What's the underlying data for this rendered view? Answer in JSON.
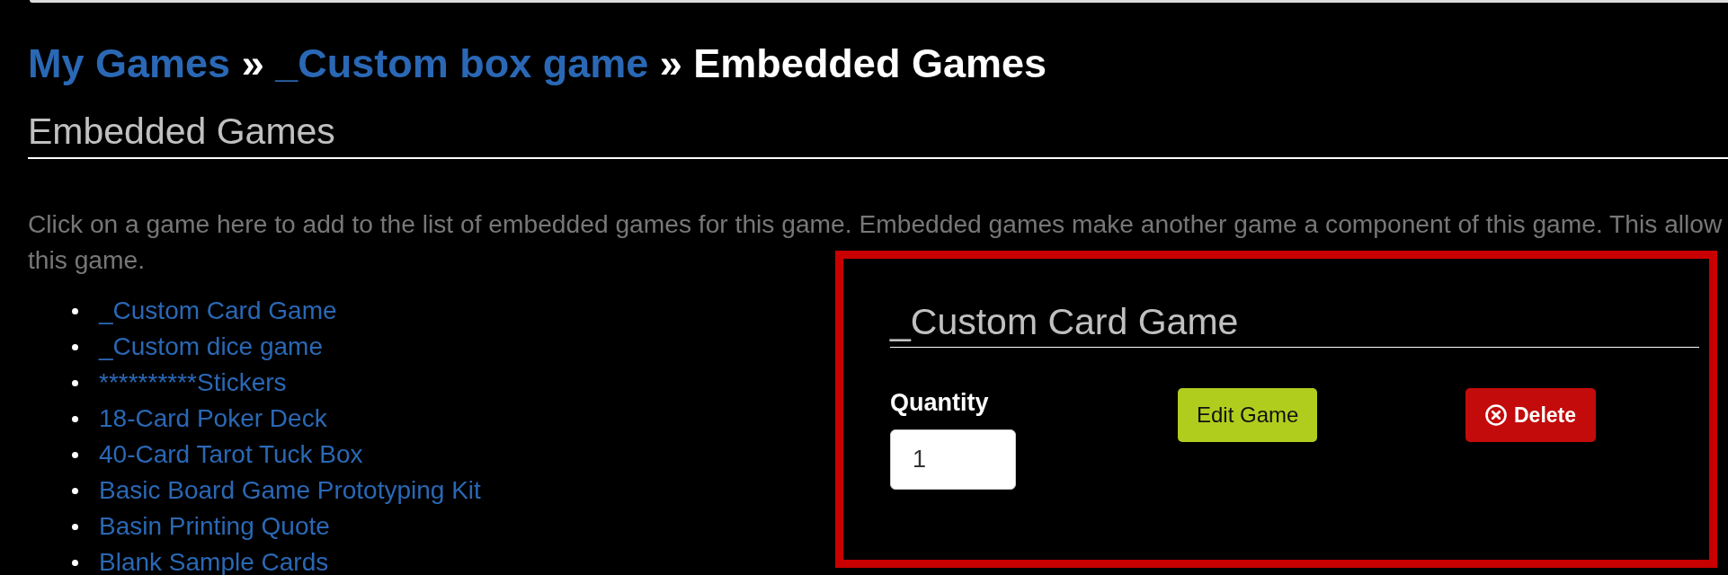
{
  "breadcrumb": {
    "items": [
      {
        "label": "My Games",
        "current": false
      },
      {
        "label": "_Custom box game",
        "current": false
      },
      {
        "label": "Embedded Games",
        "current": true
      }
    ],
    "separators": [
      "»",
      "»"
    ]
  },
  "heading": "Embedded Games",
  "description": {
    "lines": [
      "Click on a game here to add to the list of embedded games for this game. Embedded games make another game a component of this game. This allow",
      "this game."
    ]
  },
  "games": [
    "_Custom Card Game",
    "_Custom dice game",
    "**********Stickers",
    "18-Card Poker Deck",
    "40-Card Tarot Tuck Box",
    "Basic Board Game Prototyping Kit",
    "Basin Printing Quote",
    "Blank Sample Cards"
  ],
  "embedded_game": {
    "highlighted": true,
    "title": "_Custom Card Game",
    "quantity": {
      "label": "Quantity",
      "value": "1"
    },
    "buttons": [
      {
        "kind": "edit",
        "label": "Edit Game"
      },
      {
        "kind": "delete",
        "label": "Delete"
      }
    ]
  }
}
